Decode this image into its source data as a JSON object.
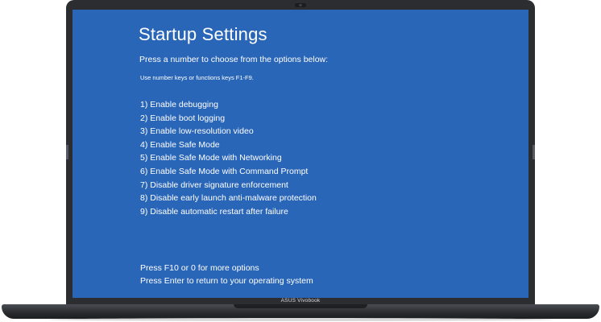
{
  "screen": {
    "title": "Startup Settings",
    "instructions": "Press a number to choose from the options below:",
    "hint": "Use number keys or functions keys F1-F9.",
    "options": [
      "1) Enable debugging",
      "2) Enable boot logging",
      "3) Enable low-resolution video",
      "4) Enable Safe Mode",
      "5) Enable Safe Mode with Networking",
      "6) Enable Safe Mode with Command Prompt",
      "7) Disable driver signature enforcement",
      "8) Disable early launch anti-malware protection",
      "9) Disable automatic restart after failure"
    ],
    "footer": {
      "more_options": "Press F10 or 0 for more options",
      "return": "Press Enter to return to your operating system"
    }
  },
  "device": {
    "brand_label": "ASUS Vivobook"
  },
  "colors": {
    "screen_background": "#2a66b8",
    "text": "#ffffff",
    "bezel": "#2b2d31"
  }
}
